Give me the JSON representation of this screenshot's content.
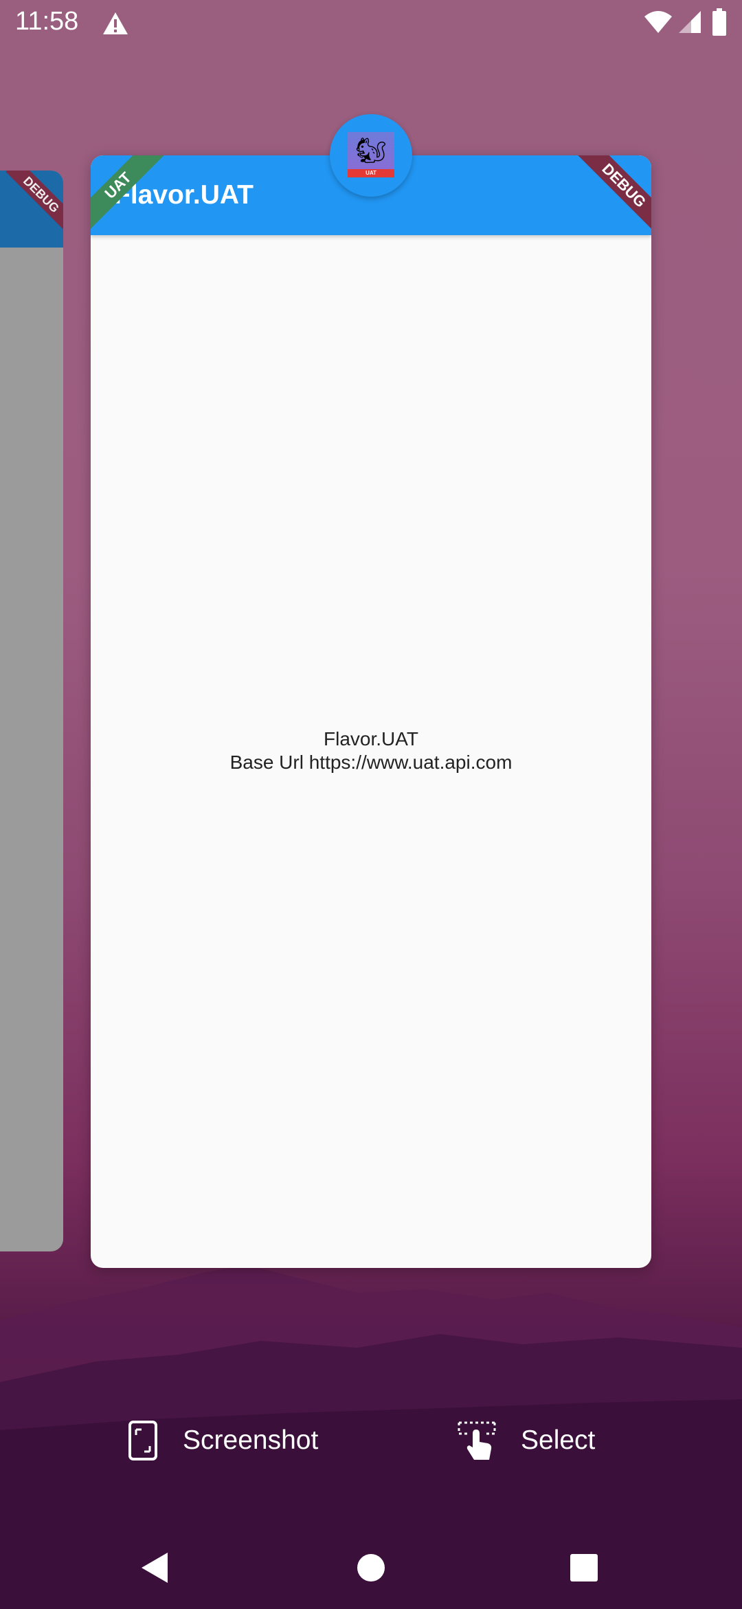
{
  "status_bar": {
    "time": "11:58",
    "icons": [
      "warning-icon",
      "wifi-icon",
      "cell-signal-icon",
      "battery-icon"
    ]
  },
  "recents": {
    "left_card": {
      "ribbon": "DEBUG"
    },
    "main_card": {
      "ribbon_left": "UAT",
      "ribbon_right": "DEBUG",
      "appbar_title": "Flavor.UAT",
      "body_line1": "Flavor.UAT",
      "body_line2": "Base Url https://www.uat.api.com",
      "app_icon": {
        "emoji": "🐿",
        "badge": "UAT"
      },
      "colors": {
        "appbar": "#2196f3",
        "background": "#fafafa"
      }
    }
  },
  "actions": {
    "screenshot_label": "Screenshot",
    "select_label": "Select"
  },
  "nav": {
    "icons": [
      "back-icon",
      "home-icon",
      "recents-icon"
    ]
  }
}
